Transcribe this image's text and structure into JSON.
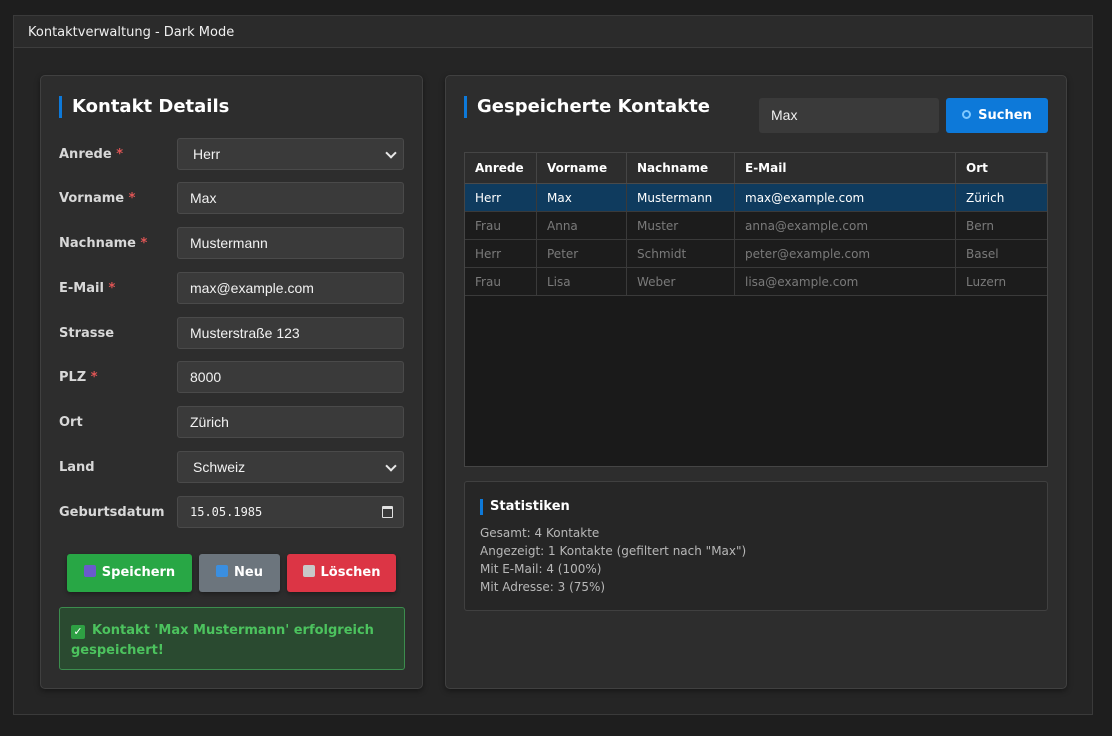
{
  "window": {
    "title": "Kontaktverwaltung - Dark Mode"
  },
  "form": {
    "heading": "Kontakt Details",
    "required_marker": "*",
    "fields": {
      "anrede": {
        "label": "Anrede",
        "value": "Herr",
        "required": true
      },
      "vorname": {
        "label": "Vorname",
        "value": "Max",
        "required": true
      },
      "nachname": {
        "label": "Nachname",
        "value": "Mustermann",
        "required": true
      },
      "email": {
        "label": "E-Mail",
        "value": "max@example.com",
        "required": true
      },
      "strasse": {
        "label": "Strasse",
        "value": "Musterstraße 123",
        "required": false
      },
      "plz": {
        "label": "PLZ",
        "value": "8000",
        "required": true
      },
      "ort": {
        "label": "Ort",
        "value": "Zürich",
        "required": false
      },
      "land": {
        "label": "Land",
        "value": "Schweiz",
        "required": false
      },
      "geburtsdatum": {
        "label": "Geburtsdatum",
        "value": "15.05.1985",
        "required": false
      }
    },
    "buttons": {
      "save": {
        "label": "Speichern",
        "icon": "floppy-disk-icon",
        "color": "#28a745"
      },
      "new": {
        "label": "Neu",
        "icon": "refresh-icon",
        "color": "#6c757d"
      },
      "delete": {
        "label": "Löschen",
        "icon": "wastebasket-icon",
        "color": "#dc3545"
      }
    },
    "success_message": "Kontakt 'Max Mustermann' erfolgreich gespeichert!"
  },
  "contacts": {
    "heading": "Gespeicherte Kontakte",
    "search": {
      "value": "Max",
      "button_label": "Suchen"
    },
    "columns": [
      "Anrede",
      "Vorname",
      "Nachname",
      "E-Mail",
      "Ort"
    ],
    "rows": [
      [
        "Herr",
        "Max",
        "Mustermann",
        "max@example.com",
        "Zürich"
      ],
      [
        "Frau",
        "Anna",
        "Muster",
        "anna@example.com",
        "Bern"
      ],
      [
        "Herr",
        "Peter",
        "Schmidt",
        "peter@example.com",
        "Basel"
      ],
      [
        "Frau",
        "Lisa",
        "Weber",
        "lisa@example.com",
        "Luzern"
      ]
    ]
  },
  "stats": {
    "title": "Statistiken",
    "lines": [
      "Gesamt: 4 Kontakte",
      "Angezeigt: 1 Kontakte (gefiltert nach \"Max\")",
      "Mit E-Mail: 4 (100%)",
      "Mit Adresse: 3 (75%)"
    ]
  },
  "colors": {
    "accent": "#0d79d9",
    "background": "#1e1e1e",
    "panel": "#2d2d2d",
    "selected_row": "#0f3b5e",
    "success_text": "#4cc35e"
  }
}
